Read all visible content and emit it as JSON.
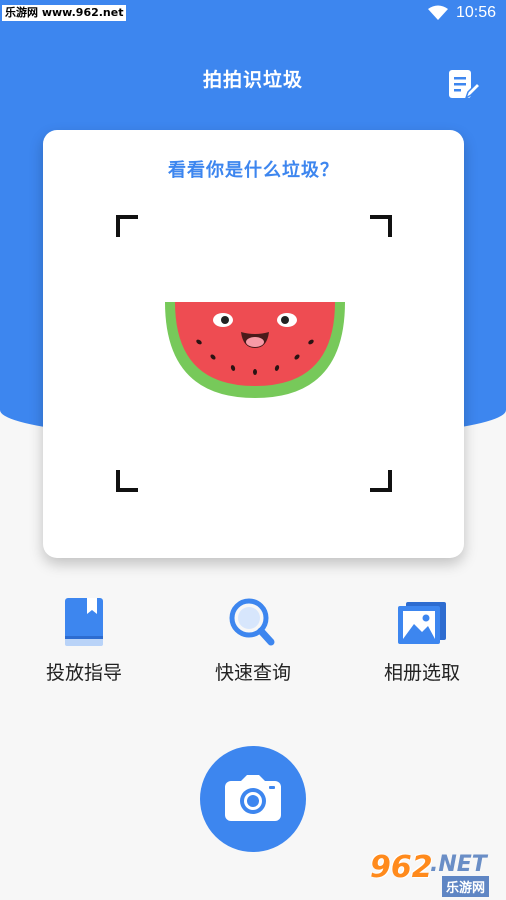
{
  "status_bar": {
    "watermark": "乐游网 www.962.net",
    "time": "10:56"
  },
  "header": {
    "title": "拍拍识垃圾",
    "notes_icon": "notes-edit-icon"
  },
  "scan_card": {
    "prompt": "看看你是什么垃圾？",
    "illustration": "watermelon"
  },
  "actions": [
    {
      "label": "投放指导",
      "icon": "book-icon"
    },
    {
      "label": "快速查询",
      "icon": "search-icon"
    },
    {
      "label": "相册选取",
      "icon": "album-icon"
    }
  ],
  "camera_button": {
    "icon": "camera-icon"
  },
  "watermark_bottom": {
    "number": "962",
    "net": ".NET",
    "cn": "乐游网"
  },
  "colors": {
    "primary": "#3d86ef",
    "background": "#f7f7f7",
    "card": "#ffffff"
  }
}
